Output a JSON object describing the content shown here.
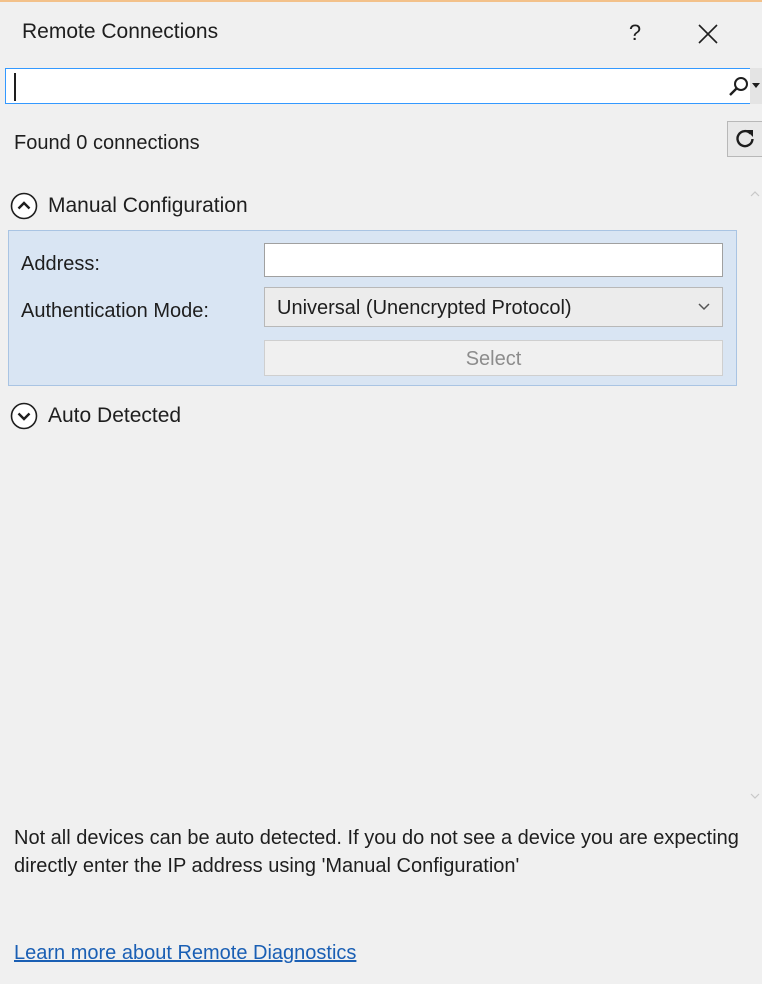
{
  "window": {
    "title": "Remote Connections",
    "help_label": "?",
    "close_icon": "close-icon"
  },
  "search": {
    "value": "",
    "placeholder": "",
    "icon": "search-icon"
  },
  "status": {
    "found_text": "Found 0 connections",
    "refresh_icon": "refresh-icon"
  },
  "manual": {
    "header_label": "Manual Configuration",
    "expanded": true,
    "address_label": "Address:",
    "address_value": "",
    "auth_label": "Authentication Mode:",
    "auth_selected": "Universal (Unencrypted Protocol)",
    "select_label": "Select"
  },
  "auto": {
    "header_label": "Auto Detected",
    "expanded": false
  },
  "footer": {
    "info_text": "Not all devices can be auto detected. If you do not see a device you are expecting directly enter the IP address using 'Manual Configuration'",
    "link_label": "Learn more about Remote Diagnostics"
  },
  "colors": {
    "accent": "#3399ff",
    "panel_bg": "#d9e5f3",
    "link": "#1a5fb4"
  }
}
